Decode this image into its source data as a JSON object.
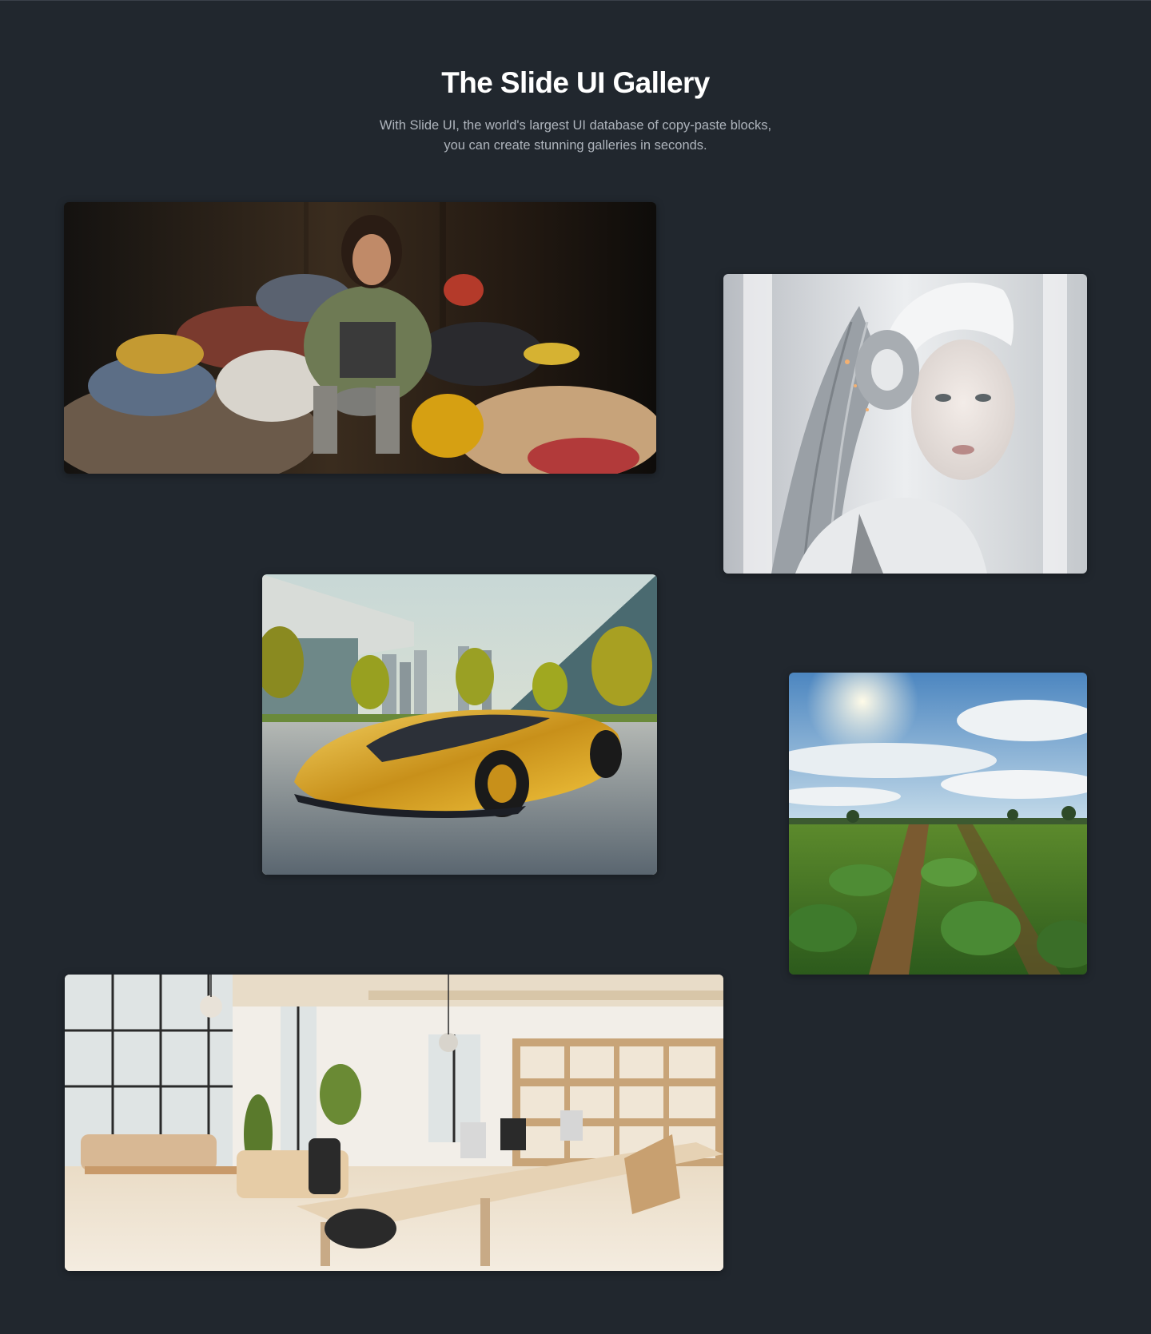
{
  "header": {
    "title": "The Slide UI Gallery",
    "subtitle_line1": "With Slide UI, the world's largest UI database of copy-paste blocks,",
    "subtitle_line2": "you can create stunning galleries in seconds."
  },
  "colors": {
    "background": "#21272e",
    "title": "#ffffff",
    "subtitle": "#aeb4bc"
  },
  "gallery": [
    {
      "name": "woman-with-clothes-pile-image"
    },
    {
      "name": "android-portrait-image"
    },
    {
      "name": "golden-concept-car-image"
    },
    {
      "name": "vegetable-field-image"
    },
    {
      "name": "bright-office-interior-image"
    }
  ]
}
